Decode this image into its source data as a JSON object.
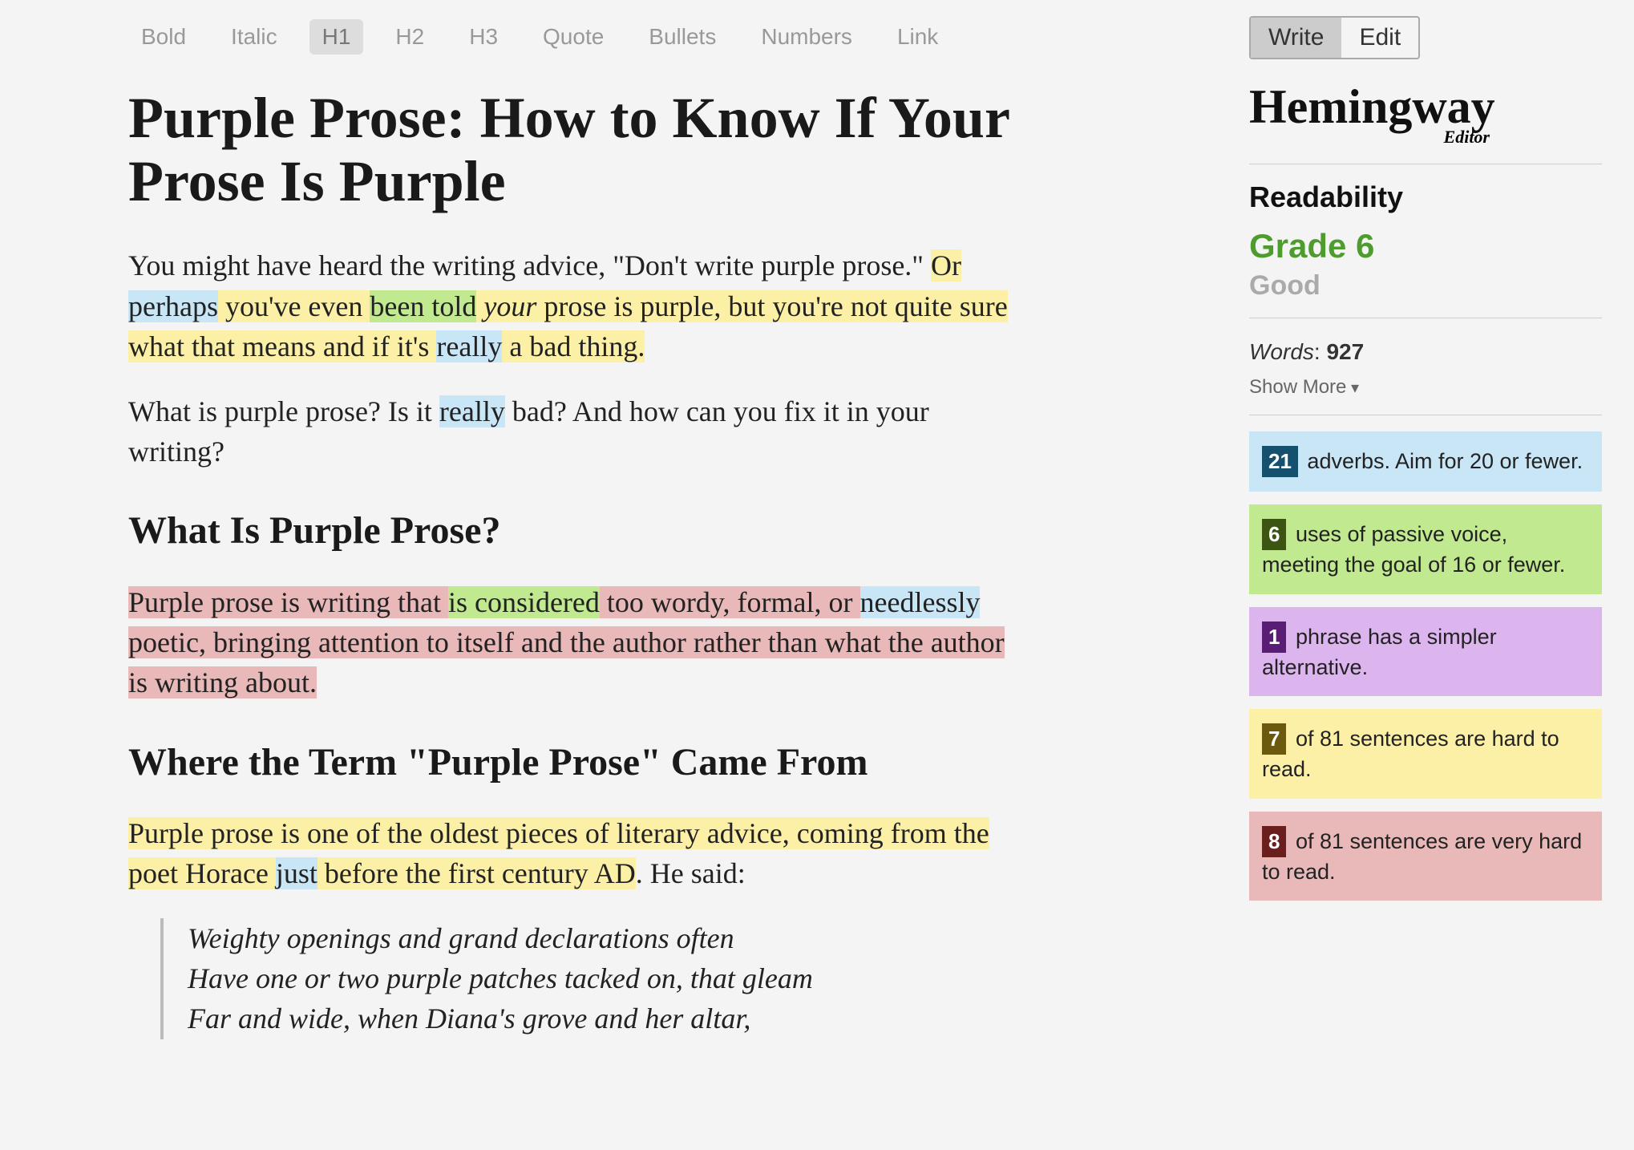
{
  "toolbar": {
    "bold": "Bold",
    "italic": "Italic",
    "h1": "H1",
    "h2": "H2",
    "h3": "H3",
    "quote": "Quote",
    "bullets": "Bullets",
    "numbers": "Numbers",
    "link": "Link"
  },
  "modes": {
    "write": "Write",
    "edit": "Edit"
  },
  "brand": {
    "name": "Hemingway",
    "sub": "Editor"
  },
  "readability": {
    "title": "Readability",
    "grade": "Grade 6",
    "quality": "Good",
    "words_label": "Words",
    "words_value": "927",
    "show_more": "Show More"
  },
  "stats": {
    "adverb_num": "21",
    "adverb_text": " adverbs. Aim for 20 or fewer.",
    "passive_num": "6",
    "passive_text": " uses of passive voice, meeting the goal of 16 or fewer.",
    "complex_num": "1",
    "complex_text": " phrase has a simpler alternative.",
    "hard_num": "7",
    "hard_text": " of 81 sentences are hard to read.",
    "veryhard_num": "8",
    "veryhard_text": " of 81 sentences are very hard to read."
  },
  "doc": {
    "h1": "Purple Prose: How to Know If Your Prose Is Purple",
    "p1a": "You might have heard the writing advice, \"Don't write purple prose.\" ",
    "p1b_pre": "Or ",
    "p1b_adv1": "perhaps",
    "p1b_mid1": " you've even ",
    "p1b_pass": "been told",
    "p1b_mid1b": " ",
    "p1b_ital": "your",
    "p1b_mid2": " prose is purple, but you're not quite sure what that means and if it's ",
    "p1b_adv2": "really",
    "p1b_end": " a bad thing.",
    "p2a": "What is purple prose? Is it ",
    "p2_adv": "really",
    "p2b": " bad? And how can you fix it in your writing?",
    "h2a": "What Is Purple Prose?",
    "p3_pre": "Purple prose is writing that ",
    "p3_pass": "is considered",
    "p3_mid": " too wordy, formal, or ",
    "p3_adv": "needlessly",
    "p3_end": " poetic, bringing attention to itself and the author rather than what the author is writing about.",
    "h2b": "Where the Term \"Purple Prose\" Came From",
    "p4_pre": "Purple prose is one of the oldest pieces  of literary advice, coming from the poet Horace ",
    "p4_adv": "just",
    "p4_post": " before the first century AD",
    "p4_end": ". He said:",
    "bq_l1": "Weighty openings and grand declarations often",
    "bq_l2": "Have one or two purple patches tacked on, that gleam",
    "bq_l3": "Far and wide, when Diana's grove and her altar,"
  }
}
